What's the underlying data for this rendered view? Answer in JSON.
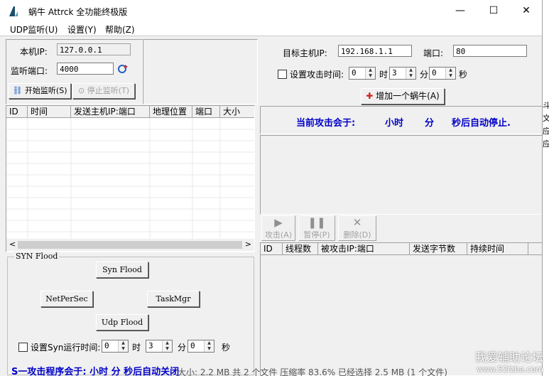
{
  "window": {
    "title": "蜗牛 Attrck 全功能终极版",
    "minimize": "—",
    "maximize": "☐",
    "close": "✕"
  },
  "menu": [
    "UDP监听(U)",
    "设置(Y)",
    "帮助(Z)"
  ],
  "left": {
    "local_ip_label": "本机IP:",
    "local_ip_value": "127.0.0.1",
    "listen_port_label": "监听端口:",
    "listen_port_value": "4000",
    "start_listen": "开始监听(S)",
    "stop_listen": "停止监听(T)",
    "table_headers": [
      "ID",
      "时间",
      "发送主机IP:端口",
      "地理位置",
      "端口",
      "大小"
    ],
    "scroll_left": "<",
    "scroll_right": ">"
  },
  "syn": {
    "group_title": "SYN Flood",
    "syn_flood": "Syn Flood",
    "netpersec": "NetPerSec",
    "taskmgr": "TaskMgr",
    "udp_flood": "Udp Flood",
    "set_time_label": "设置Syn运行时间:",
    "hours": "0",
    "hour_unit": "时",
    "minutes": "3",
    "minute_unit": "分",
    "seconds": "0",
    "second_unit": "秒",
    "status_text": "S一攻击程序会于:    小时      分      秒后自动关闭"
  },
  "right": {
    "target_ip_label": "目标主机IP:",
    "target_ip_value": "192.168.1.1",
    "port_label": "端口:",
    "port_value": "80",
    "set_attack_time_label": "设置攻击时间:",
    "hours": "0",
    "hour_unit": "时",
    "minutes": "3",
    "minute_unit": "分",
    "seconds": "0",
    "second_unit": "秒",
    "add_snail": "增加一个蜗牛(A)",
    "status_prefix": "当前攻击会于:",
    "status_hour": "小时",
    "status_minute": "分",
    "status_suffix": "秒后自动停止.",
    "attack_btn": "攻击(A)",
    "pause_btn": "暂停(P)",
    "delete_btn": "删除(D)",
    "table_headers": [
      "ID",
      "线程数",
      "被攻击IP:端口",
      "发送字节数",
      "持续时间"
    ]
  },
  "background": {
    "status_line": "大小: 2.2 MB 共 2 个文件 压缩率 83.6% 已经选择 2.5 MB (1 个文件)",
    "side_chars": [
      "斗",
      "文",
      "应",
      "应"
    ],
    "watermark_line1": "我爱辅助论坛",
    "watermark_line2": "www.52fzba.com"
  },
  "colors": {
    "status_blue": "#0000c8",
    "window_bg": "#f0f0f0"
  }
}
